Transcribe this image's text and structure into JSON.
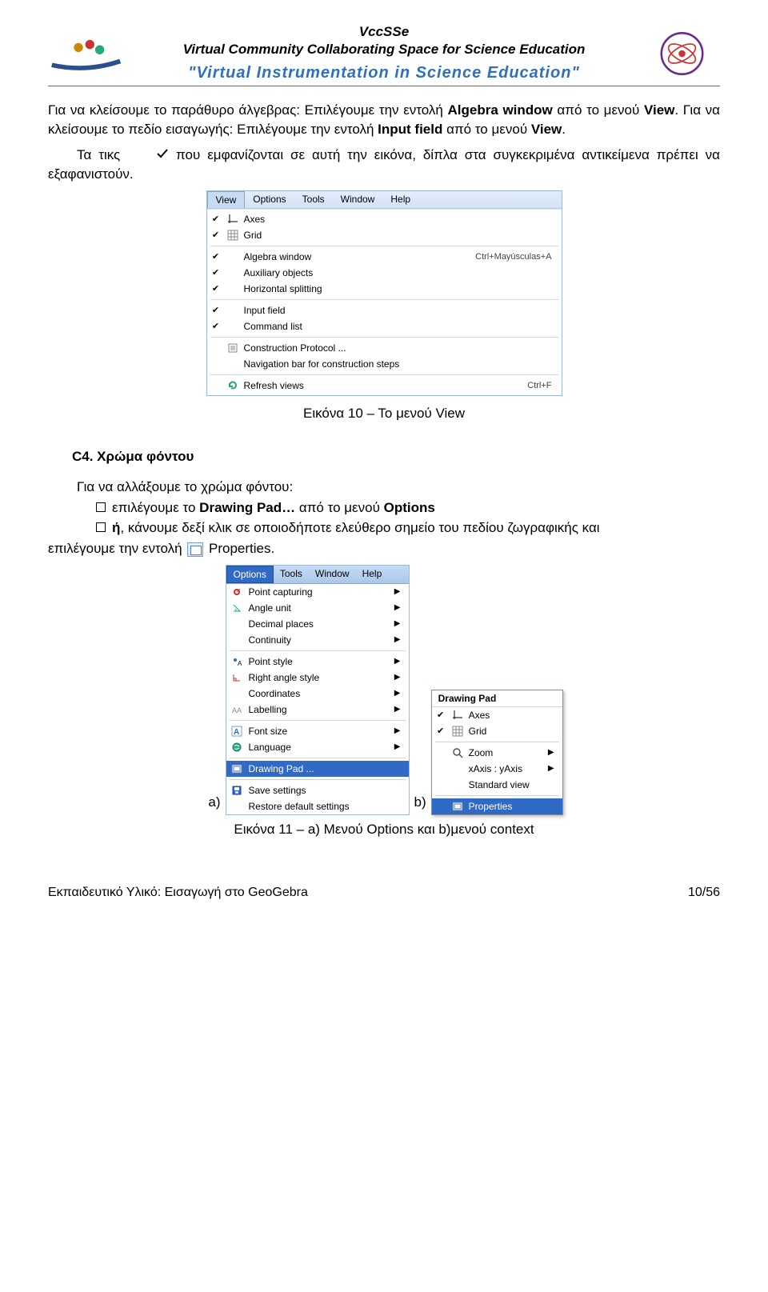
{
  "header": {
    "title1": "VccSSe",
    "title2": "Virtual Community Collaborating Space for Science Education",
    "subtitle": "\"Virtual Instrumentation in Science Education\""
  },
  "para1_pre": "Για να κλείσουμε το παράθυρο άλγεβρας: Επιλέγουμε την εντολή ",
  "para1_b1": "Algebra window",
  "para1_mid": " από το μενού ",
  "para1_b2": "View",
  "para1_end": ". Για να κλείσουμε το πεδίο εισαγωγής: Επιλέγουμε την εντολή ",
  "para1_b3": "Input field",
  "para1_mid2": " από το μενού ",
  "para1_b4": "View",
  "para1_dot": ".",
  "para2_pre": "Τα τικς ",
  "para2_post": " που εμφανίζονται σε αυτή την εικόνα, δίπλα στα συγκεκριμένα αντικείμενα πρέπει να εξαφανιστούν.",
  "view_menu": {
    "bar": [
      "View",
      "Options",
      "Tools",
      "Window",
      "Help"
    ],
    "rows": [
      {
        "check": true,
        "icon": "axes",
        "label": "Axes"
      },
      {
        "check": true,
        "icon": "grid",
        "label": "Grid"
      },
      {
        "sep": true
      },
      {
        "check": true,
        "label": "Algebra window",
        "shortcut": "Ctrl+Mayúsculas+A"
      },
      {
        "check": true,
        "label": "Auxiliary objects"
      },
      {
        "check": true,
        "label": "Horizontal splitting"
      },
      {
        "sep": true
      },
      {
        "check": true,
        "label": "Input field"
      },
      {
        "check": true,
        "label": "Command list"
      },
      {
        "sep": true
      },
      {
        "icon": "protocol",
        "label": "Construction Protocol ..."
      },
      {
        "label": "Navigation bar for construction steps"
      },
      {
        "sep": true
      },
      {
        "icon": "refresh",
        "label": "Refresh views",
        "shortcut": "Ctrl+F"
      }
    ]
  },
  "caption1": "Εικόνα 10 – Το μενού View",
  "section_c4": "C4. Χρώμα φόντου",
  "bullets_intro": "Για να αλλάξουμε το χρώμα φόντου:",
  "bullet1_pre": "επιλέγουμε το ",
  "bullet1_b1": "Drawing Pad…",
  "bullet1_mid": " από το μενού ",
  "bullet1_b2": "Options",
  "bullet2_pre": "ή",
  "bullet2_txt": ", κάνουμε δεξί κλικ σε οποιοδήποτε ελεύθερο σημείο του πεδίου ζωγραφικής και",
  "line_after_pre": "επιλέγουμε την εντολή ",
  "line_after_b": " Properties.",
  "options_menu": {
    "bar": [
      "Options",
      "Tools",
      "Window",
      "Help"
    ],
    "rows": [
      {
        "icon": "pointcap",
        "label": "Point capturing",
        "arrow": true
      },
      {
        "icon": "angle",
        "label": "Angle unit",
        "arrow": true
      },
      {
        "label": "Decimal places",
        "arrow": true
      },
      {
        "label": "Continuity",
        "arrow": true
      },
      {
        "sep": true
      },
      {
        "icon": "pointstyle",
        "label": "Point style",
        "arrow": true
      },
      {
        "icon": "rightangle",
        "label": "Right angle style",
        "arrow": true
      },
      {
        "label": "Coordinates",
        "arrow": true
      },
      {
        "icon": "aa",
        "label": "Labelling",
        "arrow": true
      },
      {
        "sep": true
      },
      {
        "icon": "font",
        "label": "Font size",
        "arrow": true
      },
      {
        "icon": "globe",
        "label": "Language",
        "arrow": true
      },
      {
        "sep": true
      },
      {
        "icon": "pad",
        "label": "Drawing Pad ...",
        "sel": true
      },
      {
        "sep": true
      },
      {
        "icon": "save",
        "label": "Save settings"
      },
      {
        "label": "Restore default settings"
      }
    ]
  },
  "context_menu": {
    "header": "Drawing Pad",
    "rows": [
      {
        "check": true,
        "icon": "axes",
        "label": "Axes"
      },
      {
        "check": true,
        "icon": "grid",
        "label": "Grid"
      },
      {
        "sep": true
      },
      {
        "icon": "zoom",
        "label": "Zoom",
        "arrow": true
      },
      {
        "label": "xAxis : yAxis",
        "arrow": true
      },
      {
        "label": "Standard view"
      },
      {
        "sep": true
      },
      {
        "icon": "pad",
        "label": "Properties",
        "sel": true
      }
    ]
  },
  "label_a": "a)",
  "label_b": "b)",
  "caption2": "Εικόνα 11 – a) Μενού Options και b)μενού context",
  "footer_left": "Εκπαιδευτικό Υλικό: Εισαγωγή στο GeoGebra",
  "footer_right": "10/56"
}
